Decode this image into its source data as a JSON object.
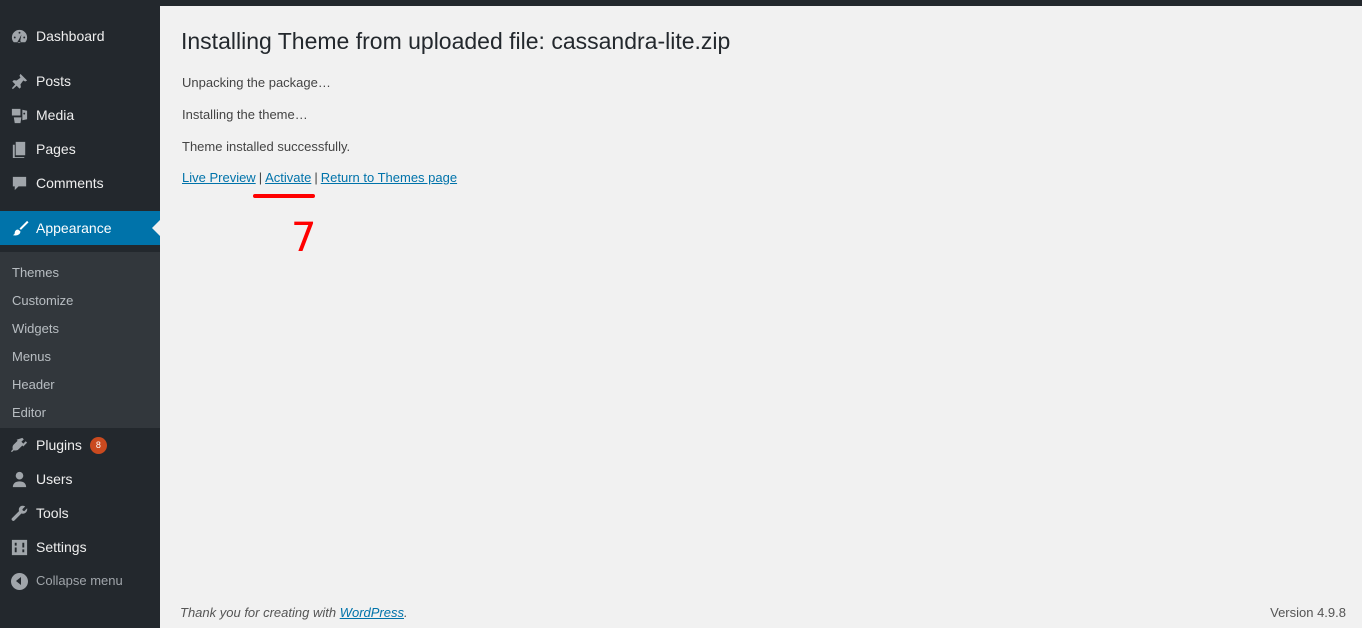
{
  "sidebar": {
    "items": [
      {
        "label": "Dashboard",
        "icon": "dashboard-icon"
      },
      {
        "label": "Posts",
        "icon": "pin-icon"
      },
      {
        "label": "Media",
        "icon": "media-icon"
      },
      {
        "label": "Pages",
        "icon": "pages-icon"
      },
      {
        "label": "Comments",
        "icon": "comment-icon"
      },
      {
        "label": "Appearance",
        "icon": "brush-icon"
      },
      {
        "label": "Plugins",
        "icon": "plug-icon",
        "badge": "8"
      },
      {
        "label": "Users",
        "icon": "user-icon"
      },
      {
        "label": "Tools",
        "icon": "wrench-icon"
      },
      {
        "label": "Settings",
        "icon": "settings-icon"
      },
      {
        "label": "Collapse menu",
        "icon": "collapse-icon"
      }
    ],
    "submenu": [
      "Themes",
      "Customize",
      "Widgets",
      "Menus",
      "Header",
      "Editor"
    ],
    "current_color": "#0073aa",
    "badge_color": "#ca4a1f"
  },
  "main": {
    "title": "Installing Theme from uploaded file: cassandra-lite.zip",
    "steps": [
      "Unpacking the package…",
      "Installing the theme…",
      "Theme installed successfully."
    ],
    "links": {
      "live_preview": "Live Preview",
      "activate": "Activate",
      "return": "Return to Themes page",
      "separator": "|"
    },
    "annotation": {
      "number": "7",
      "color": "#ff0000"
    }
  },
  "footer": {
    "thanks_prefix": "Thank you for creating with ",
    "wordpress_link": "WordPress",
    "thanks_suffix": ".",
    "version": "Version 4.9.8"
  }
}
